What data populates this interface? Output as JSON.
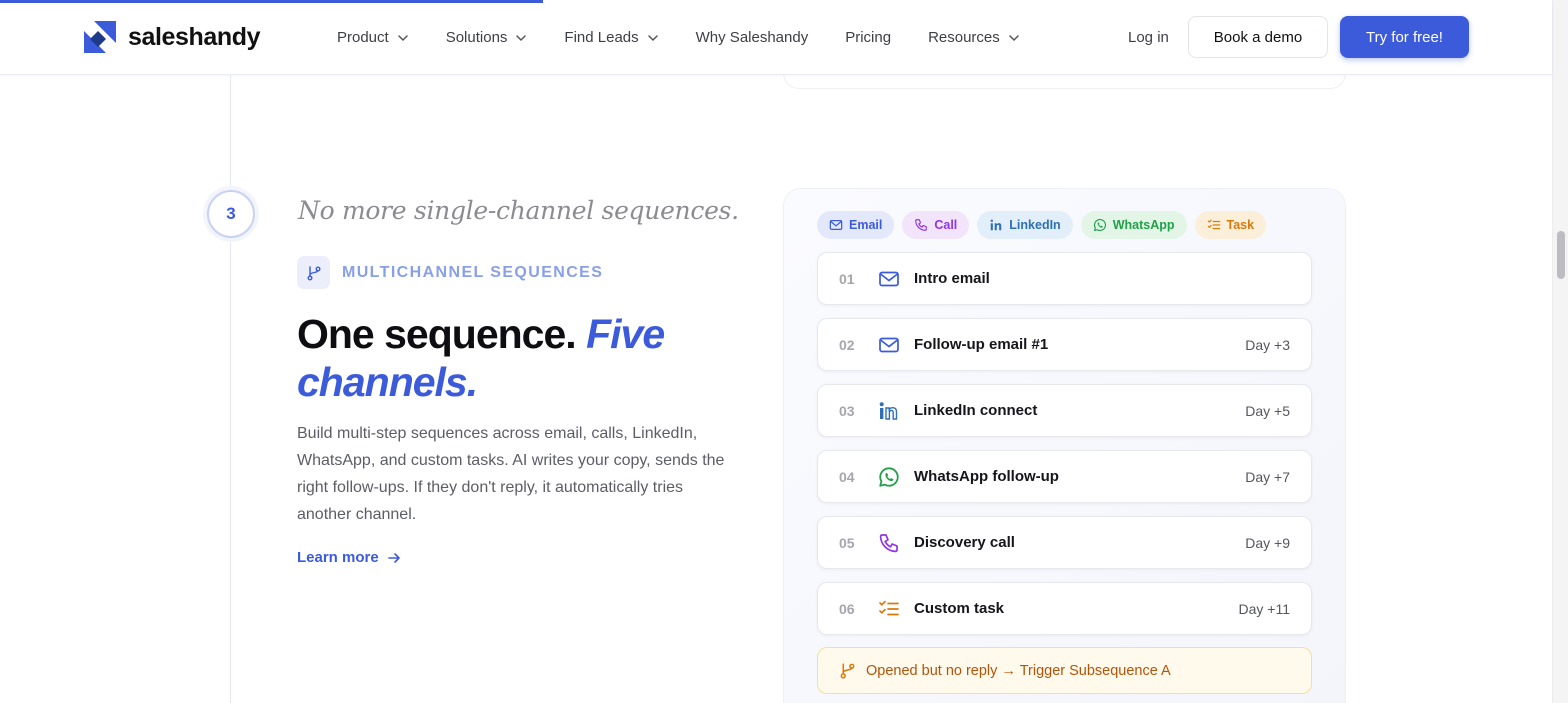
{
  "header": {
    "brand": "saleshandy",
    "nav": [
      {
        "label": "Product",
        "dropdown": true
      },
      {
        "label": "Solutions",
        "dropdown": true
      },
      {
        "label": "Find Leads",
        "dropdown": true
      },
      {
        "label": "Why Saleshandy",
        "dropdown": false
      },
      {
        "label": "Pricing",
        "dropdown": false
      },
      {
        "label": "Resources",
        "dropdown": true
      }
    ],
    "login": "Log in",
    "demo_button": "Book a demo",
    "try_button": "Try for free!",
    "accent_color": "#3b5bdb",
    "scroll_progress": 0.35
  },
  "section": {
    "step_number": "3",
    "tagline": "No more single-channel sequences.",
    "label": "MULTICHANNEL SEQUENCES",
    "headline_plain": "One sequence.",
    "headline_accent": "Five channels.",
    "description": "Build multi-step sequences across email, calls, LinkedIn, WhatsApp, and custom tasks. AI writes your copy, sends the right follow-ups. If they don't reply, it automatically tries another channel.",
    "learn_more": "Learn more"
  },
  "card": {
    "chips": [
      {
        "label": "Email",
        "icon": "mail-icon",
        "color": "#3b5bdb"
      },
      {
        "label": "Call",
        "icon": "phone-icon",
        "color": "#9333ea"
      },
      {
        "label": "LinkedIn",
        "icon": "linkedin-icon",
        "color": "#2f6fb3"
      },
      {
        "label": "WhatsApp",
        "icon": "whatsapp-icon",
        "color": "#22a04a"
      },
      {
        "label": "Task",
        "icon": "task-list-icon",
        "color": "#d97a0c"
      }
    ],
    "steps": [
      {
        "num": "01",
        "title": "Intro email",
        "day": "",
        "icon": "mail-icon"
      },
      {
        "num": "02",
        "title": "Follow-up email #1",
        "day": "Day +3",
        "icon": "mail-icon"
      },
      {
        "num": "03",
        "title": "LinkedIn connect",
        "day": "Day +5",
        "icon": "linkedin-icon"
      },
      {
        "num": "04",
        "title": "WhatsApp follow-up",
        "day": "Day +7",
        "icon": "whatsapp-icon"
      },
      {
        "num": "05",
        "title": "Discovery call",
        "day": "Day +9",
        "icon": "phone-icon"
      },
      {
        "num": "06",
        "title": "Custom task",
        "day": "Day +11",
        "icon": "task-list-icon"
      }
    ],
    "trigger": "Opened but no reply → Trigger Subsequence A"
  }
}
